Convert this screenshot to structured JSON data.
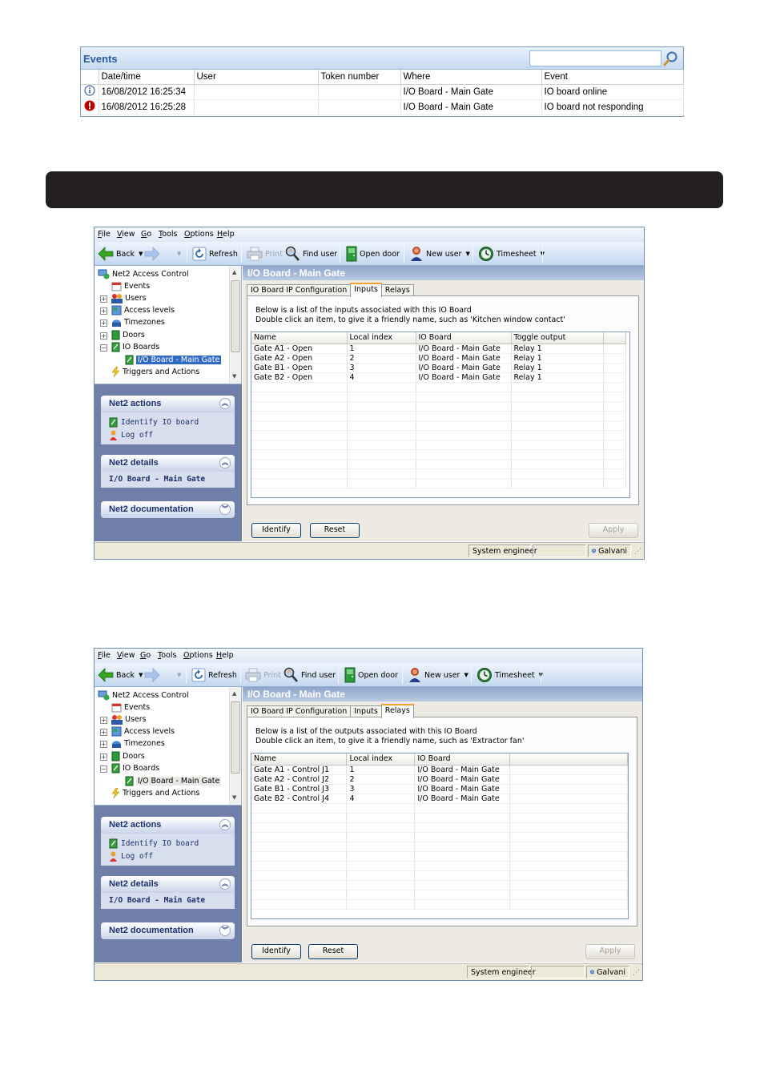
{
  "events": {
    "title": "Events",
    "search_placeholder": "",
    "columns": [
      "Date/time",
      "User",
      "Token number",
      "Where",
      "Event"
    ],
    "rows": [
      {
        "icon": "info-icon",
        "datetime": "16/08/2012  16:25:34",
        "user": "",
        "token": "",
        "where": "I/O Board - Main Gate",
        "event": "IO board online"
      },
      {
        "icon": "error-icon",
        "datetime": "16/08/2012  16:25:28",
        "user": "",
        "token": "",
        "where": "I/O Board - Main Gate",
        "event": "IO board not responding"
      }
    ]
  },
  "app": {
    "menu": [
      "File",
      "View",
      "Go",
      "Tools",
      "Options",
      "Help"
    ],
    "toolbar": {
      "back": "Back",
      "refresh": "Refresh",
      "print": "Print",
      "find_user": "Find user",
      "open_door": "Open door",
      "new_user": "New user",
      "timesheet": "Timesheet"
    },
    "tree": {
      "root": "Net2 Access Control",
      "items": [
        "Events",
        "Users",
        "Access levels",
        "Timezones",
        "Doors",
        "IO Boards",
        "I/O Board - Main Gate",
        "Triggers and Actions"
      ]
    },
    "actions": {
      "title": "Net2 actions",
      "items": [
        "Identify IO board",
        "Log off"
      ]
    },
    "details": {
      "title": "Net2 details",
      "value": "I/O Board - Main Gate"
    },
    "documentation": {
      "title": "Net2 documentation"
    },
    "main_title": "I/O Board - Main Gate",
    "tabs": [
      "IO Board IP Configuration",
      "Inputs",
      "Relays"
    ],
    "buttons": {
      "identify": "Identify",
      "reset": "Reset",
      "apply": "Apply"
    },
    "status": {
      "role": "System engineer",
      "user": "Galvani"
    }
  },
  "inputs_view": {
    "hint_line1": "Below is a list of the inputs associated with this IO Board",
    "hint_line2": "Double click an item, to give it a friendly name, such as 'Kitchen window contact'",
    "columns": [
      "Name",
      "Local index",
      "IO Board",
      "Toggle output"
    ],
    "rows": [
      [
        "Gate A1 - Open",
        "1",
        "I/O Board - Main Gate",
        "Relay 1"
      ],
      [
        "Gate A2 - Open",
        "2",
        "I/O Board - Main Gate",
        "Relay 1"
      ],
      [
        "Gate B1 - Open",
        "3",
        "I/O Board - Main Gate",
        "Relay 1"
      ],
      [
        "Gate B2 - Open",
        "4",
        "I/O Board - Main Gate",
        "Relay 1"
      ]
    ]
  },
  "relays_view": {
    "hint_line1": "Below is a list of the outputs associated with this IO Board",
    "hint_line2": "Double click an item, to give it a friendly name, such as 'Extractor fan'",
    "columns": [
      "Name",
      "Local index",
      "IO Board"
    ],
    "rows": [
      [
        "Gate A1 - Control J1",
        "1",
        "I/O Board - Main Gate"
      ],
      [
        "Gate A2 - Control J2",
        "2",
        "I/O Board - Main Gate"
      ],
      [
        "Gate B1 - Control J3",
        "3",
        "I/O Board - Main Gate"
      ],
      [
        "Gate B2 - Control J4",
        "4",
        "I/O Board - Main Gate"
      ]
    ]
  },
  "colors": {
    "accent": "#316ac5",
    "sidebar": "#6f7fa8",
    "banner": "#231f20",
    "error": "#c00000",
    "active_tab": "#f3a22f"
  }
}
